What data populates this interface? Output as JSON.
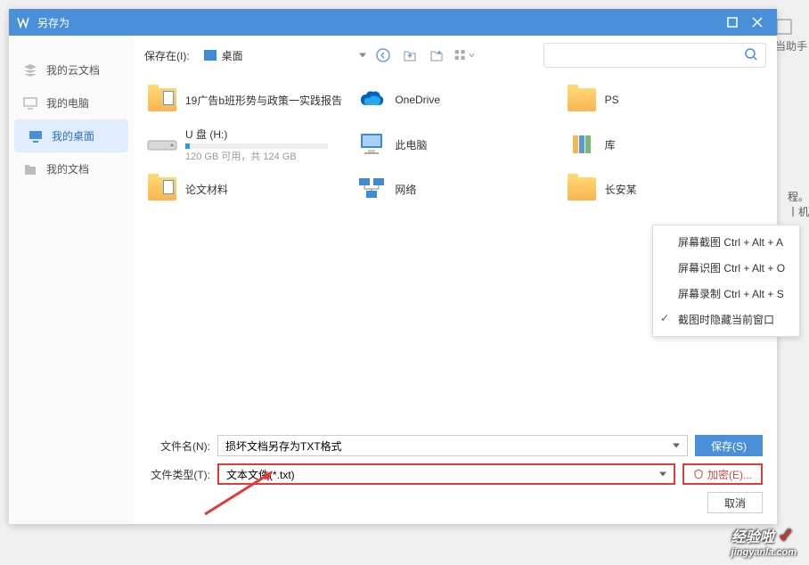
{
  "dialog": {
    "title": "另存为",
    "location_label": "保存在(I):",
    "location_value": "桌面"
  },
  "sidebar": {
    "items": [
      {
        "label": "我的云文档",
        "icon": "cloud-doc"
      },
      {
        "label": "我的电脑",
        "icon": "computer"
      },
      {
        "label": "我的桌面",
        "icon": "desktop",
        "active": true
      },
      {
        "label": "我的文档",
        "icon": "documents"
      }
    ]
  },
  "files": [
    {
      "name": "19广告b班形势与政策一实践报告",
      "type": "folder-doc"
    },
    {
      "name": "OneDrive",
      "type": "onedrive"
    },
    {
      "name": "PS",
      "type": "folder"
    },
    {
      "name": "U 盘 (H:)",
      "type": "drive",
      "sub": "120 GB 可用，共 124 GB"
    },
    {
      "name": "此电脑",
      "type": "pc"
    },
    {
      "name": "库",
      "type": "library"
    },
    {
      "name": "论文材料",
      "type": "folder-doc"
    },
    {
      "name": "网络",
      "type": "network"
    },
    {
      "name": "长安某",
      "type": "user"
    }
  ],
  "form": {
    "filename_label": "文件名(N):",
    "filename_value": "损坏文档另存为TXT格式",
    "filetype_label": "文件类型(T):",
    "filetype_value": "文本文件(*.txt)",
    "save_btn": "保存(S)",
    "encrypt_btn": "加密(E)...",
    "cancel_btn": "取消"
  },
  "context_menu": {
    "items": [
      {
        "label": "屏幕截图 Ctrl + Alt + A"
      },
      {
        "label": "屏幕识图 Ctrl + Alt + O"
      },
      {
        "label": "屏幕录制 Ctrl + Alt + S"
      },
      {
        "label": "截图时隐藏当前窗口",
        "checked": true
      }
    ]
  },
  "bg": {
    "helper": "当助手",
    "side1": "程。",
    "side2": "丨机"
  },
  "watermark": {
    "brand": "经验啦",
    "url": "jingyanla.com"
  }
}
